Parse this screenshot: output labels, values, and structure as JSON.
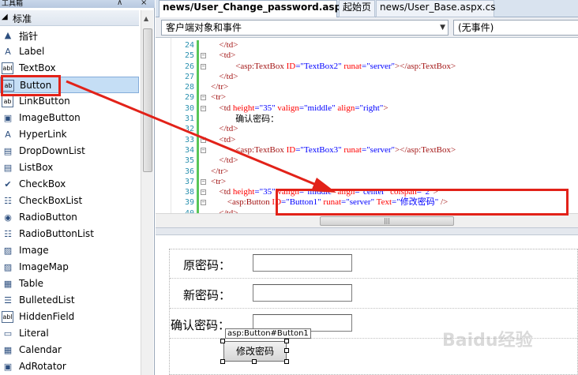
{
  "toolbox": {
    "title": "工具箱",
    "pin_glyph": "⊼",
    "close_glyph": "×",
    "group_label": "标准",
    "items": [
      {
        "label": "指针",
        "icon": "pointer-icon",
        "glyph": "▲"
      },
      {
        "label": "Label",
        "icon": "label-icon",
        "glyph": "A"
      },
      {
        "label": "TextBox",
        "icon": "textbox-icon",
        "glyph": "abl"
      },
      {
        "label": "Button",
        "icon": "button-icon",
        "glyph": "ab"
      },
      {
        "label": "LinkButton",
        "icon": "linkbutton-icon",
        "glyph": "ab"
      },
      {
        "label": "ImageButton",
        "icon": "imagebutton-icon",
        "glyph": "▣"
      },
      {
        "label": "HyperLink",
        "icon": "hyperlink-icon",
        "glyph": "A"
      },
      {
        "label": "DropDownList",
        "icon": "dropdownlist-icon",
        "glyph": "▤"
      },
      {
        "label": "ListBox",
        "icon": "listbox-icon",
        "glyph": "▤"
      },
      {
        "label": "CheckBox",
        "icon": "checkbox-icon",
        "glyph": "✔"
      },
      {
        "label": "CheckBoxList",
        "icon": "checkboxlist-icon",
        "glyph": "☷"
      },
      {
        "label": "RadioButton",
        "icon": "radiobutton-icon",
        "glyph": "◉"
      },
      {
        "label": "RadioButtonList",
        "icon": "radiobuttonlist-icon",
        "glyph": "☷"
      },
      {
        "label": "Image",
        "icon": "image-icon",
        "glyph": "▨"
      },
      {
        "label": "ImageMap",
        "icon": "imagemap-icon",
        "glyph": "▨"
      },
      {
        "label": "Table",
        "icon": "table-icon",
        "glyph": "▦"
      },
      {
        "label": "BulletedList",
        "icon": "bulletedlist-icon",
        "glyph": "☰"
      },
      {
        "label": "HiddenField",
        "icon": "hiddenfield-icon",
        "glyph": "abl"
      },
      {
        "label": "Literal",
        "icon": "literal-icon",
        "glyph": "▭"
      },
      {
        "label": "Calendar",
        "icon": "calendar-icon",
        "glyph": "▦"
      },
      {
        "label": "AdRotator",
        "icon": "adrotator-icon",
        "glyph": "▣"
      }
    ],
    "selected_index": 3
  },
  "tabs": [
    {
      "label": "news/User_Change_password.aspx",
      "active": true
    },
    {
      "label": "起始页",
      "active": false
    },
    {
      "label": "news/User_Base.aspx.cs",
      "active": false
    }
  ],
  "dropdowns": {
    "object": "客户端对象和事件",
    "event": "(无事件)"
  },
  "code_lines": [
    {
      "n": "24",
      "indent": 14,
      "parts": [
        [
          "tag",
          "</td>"
        ]
      ]
    },
    {
      "n": "25",
      "indent": 14,
      "parts": [
        [
          "tag",
          "<td>"
        ]
      ]
    },
    {
      "n": "26",
      "indent": 18,
      "parts": [
        [
          "tag",
          "<asp:TextBox "
        ],
        [
          "attr",
          "ID"
        ],
        [
          "val",
          "=\"TextBox2\" "
        ],
        [
          "attr",
          "runat"
        ],
        [
          "val",
          "=\"server\""
        ],
        [
          "tag",
          "></asp:TextBox>"
        ]
      ]
    },
    {
      "n": "27",
      "indent": 14,
      "parts": [
        [
          "tag",
          "</td>"
        ]
      ]
    },
    {
      "n": "28",
      "indent": 12,
      "parts": [
        [
          "tag",
          "</tr>"
        ]
      ]
    },
    {
      "n": "29",
      "indent": 12,
      "parts": [
        [
          "tag",
          "<tr>"
        ]
      ]
    },
    {
      "n": "30",
      "indent": 14,
      "parts": [
        [
          "tag",
          "<td "
        ],
        [
          "attr",
          "height"
        ],
        [
          "val",
          "=\"35\" "
        ],
        [
          "attr",
          "valign"
        ],
        [
          "val",
          "=\"middle\" "
        ],
        [
          "attr",
          "align"
        ],
        [
          "val",
          "=\"right\""
        ],
        [
          "tag",
          ">"
        ]
      ]
    },
    {
      "n": "31",
      "indent": 18,
      "parts": [
        [
          "txt",
          "确认密码："
        ]
      ]
    },
    {
      "n": "32",
      "indent": 14,
      "parts": [
        [
          "tag",
          "</td>"
        ]
      ]
    },
    {
      "n": "33",
      "indent": 14,
      "parts": [
        [
          "tag",
          "<td>"
        ]
      ]
    },
    {
      "n": "34",
      "indent": 18,
      "parts": [
        [
          "tag",
          "<asp:TextBox "
        ],
        [
          "attr",
          "ID"
        ],
        [
          "val",
          "=\"TextBox3\" "
        ],
        [
          "attr",
          "runat"
        ],
        [
          "val",
          "=\"server\""
        ],
        [
          "tag",
          "></asp:TextBox>"
        ]
      ]
    },
    {
      "n": "35",
      "indent": 14,
      "parts": [
        [
          "tag",
          "</td>"
        ]
      ]
    },
    {
      "n": "36",
      "indent": 12,
      "parts": [
        [
          "tag",
          "</tr>"
        ]
      ]
    },
    {
      "n": "37",
      "indent": 12,
      "parts": [
        [
          "tag",
          "<tr>"
        ]
      ]
    },
    {
      "n": "38",
      "indent": 14,
      "parts": [
        [
          "tag",
          "<td "
        ],
        [
          "attr",
          "height"
        ],
        [
          "val",
          "=\"35\" "
        ],
        [
          "attr",
          "valign"
        ],
        [
          "val",
          "=\"middle\" "
        ],
        [
          "attr",
          "align"
        ],
        [
          "val",
          "=\"center\" "
        ],
        [
          "attr",
          "colspan"
        ],
        [
          "val",
          "=\"2\""
        ],
        [
          "tag",
          ">"
        ]
      ]
    },
    {
      "n": "39",
      "indent": 16,
      "parts": [
        [
          "tag",
          "<asp:Button "
        ],
        [
          "attr",
          "ID"
        ],
        [
          "val",
          "=\"Button1\" "
        ],
        [
          "attr",
          "runat"
        ],
        [
          "val",
          "=\"server\" "
        ],
        [
          "attr",
          "Text"
        ],
        [
          "val",
          "=\"修改密码\""
        ],
        [
          "tag",
          " />"
        ]
      ]
    },
    {
      "n": "40",
      "indent": 14,
      "parts": [
        [
          "tag",
          "</td>"
        ]
      ]
    }
  ],
  "design": {
    "rows": [
      {
        "label": "原密码："
      },
      {
        "label": "新密码："
      },
      {
        "label": "确认密码："
      }
    ],
    "button_tag": "asp:Button#Button1",
    "button_label": "修改密码"
  },
  "watermark": "Baidu经验",
  "colors": {
    "annotation_red": "#e22219",
    "selection_blue": "#c5def5",
    "change_marker_green": "#58c658"
  }
}
